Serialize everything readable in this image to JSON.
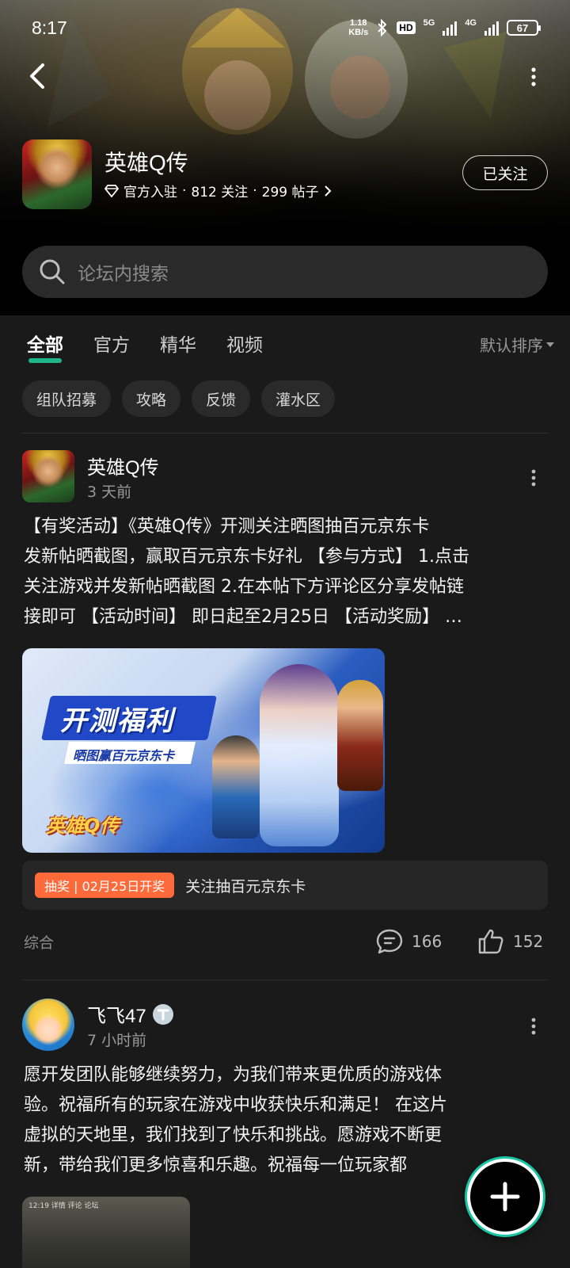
{
  "status_bar": {
    "time": "8:17",
    "net_speed_value": "1.18",
    "net_speed_unit": "KB/s",
    "hd_label": "HD",
    "signal1_label": "5G",
    "signal2_label": "4G",
    "battery": "67"
  },
  "forum": {
    "name": "英雄Q传",
    "official_label": "官方入驻",
    "followers": "812 关注",
    "posts": "299 帖子",
    "follow_button": "已关注"
  },
  "search": {
    "placeholder": "论坛内搜索"
  },
  "tabs": [
    {
      "label": "全部",
      "active": true
    },
    {
      "label": "官方",
      "active": false
    },
    {
      "label": "精华",
      "active": false
    },
    {
      "label": "视频",
      "active": false
    }
  ],
  "sort_label": "默认排序",
  "chips": [
    "组队招募",
    "攻略",
    "反馈",
    "灌水区"
  ],
  "posts": [
    {
      "author": "英雄Q传",
      "time": "3 天前",
      "text_lines": [
        "【有奖活动】《英雄Q传》开测关注晒图抽百元京东卡",
        "发新帖晒截图，赢取百元京东卡好礼 【参与方式】 1.点击",
        "关注游戏并发新帖晒截图 2.在本帖下方评论区分享发帖链",
        "接即可 【活动时间】 即日起至2月25日 【活动奖励】 …"
      ],
      "image": {
        "title": "开测福利",
        "subtitle": "晒图赢百元京东卡",
        "logo": "英雄Q传"
      },
      "lottery_badge": "抽奖 | 02月25日开奖",
      "lottery_text": "关注抽百元京东卡",
      "tag": "综合",
      "comments": "166",
      "likes": "152"
    },
    {
      "author": "飞飞47",
      "time": "7 小时前",
      "text_lines": [
        "愿开发团队能够继续努力，为我们带来更优质的游戏体",
        "验。祝福所有的玩家在游戏中收获快乐和满足！  在这片",
        "虚拟的天地里，我们找到了快乐和挑战。愿游戏不断更",
        "新，带给我们更多惊喜和乐趣。祝福每一位玩家都"
      ],
      "thumb_caption": "12:19  详情  评论  论坛"
    }
  ],
  "colors": {
    "accent": "#1fb58a",
    "lottery": "#ff6a3a",
    "background": "#1a1a1a"
  },
  "icons": [
    "back-arrow-icon",
    "more-vertical-icon",
    "diamond-icon",
    "chevron-right-icon",
    "search-icon",
    "comment-icon",
    "thumbs-up-icon",
    "plus-icon",
    "verified-icon"
  ]
}
